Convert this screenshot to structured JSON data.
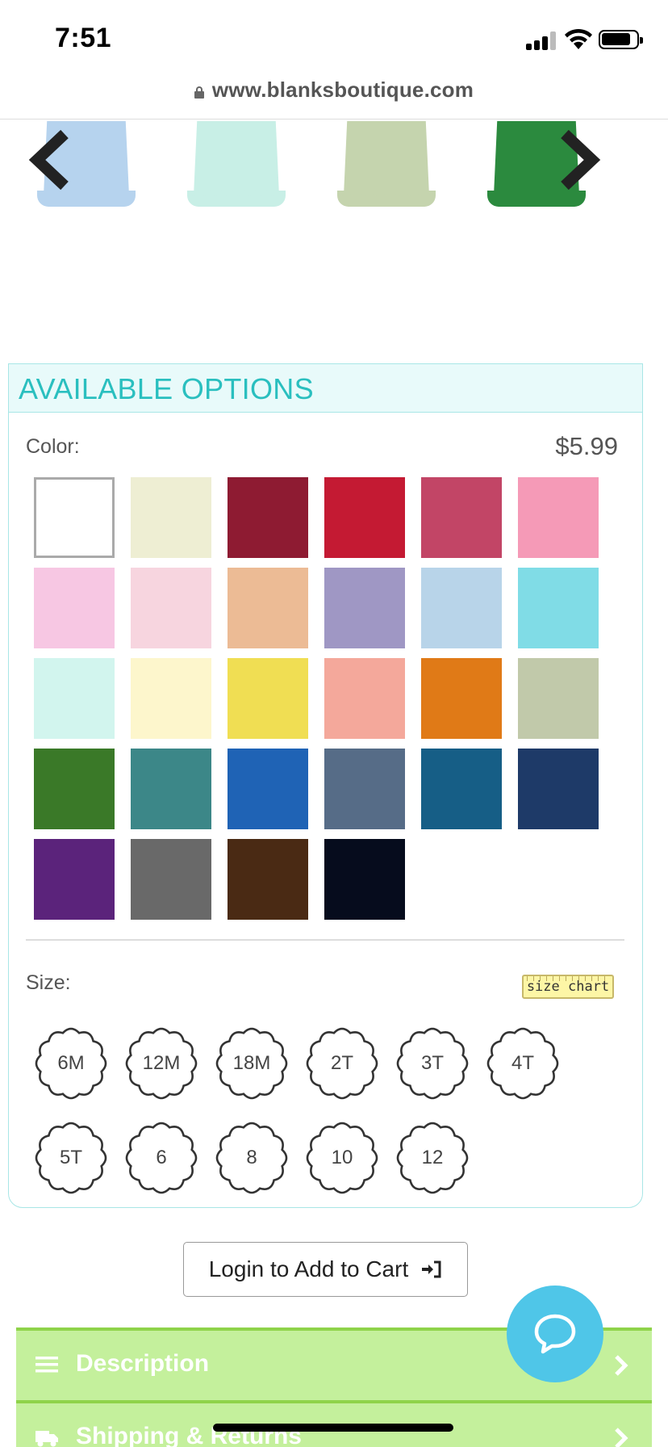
{
  "status_bar": {
    "time": "7:51"
  },
  "browser": {
    "url": "www.blanksboutique.com"
  },
  "carousel": {
    "items": [
      {
        "color": "#b6d3ee"
      },
      {
        "color": "#c8efe6"
      },
      {
        "color": "#c5d4ae"
      },
      {
        "color": "#2b8a3e"
      }
    ]
  },
  "options": {
    "title": "AVAILABLE OPTIONS",
    "color_label": "Color:",
    "price": "$5.99",
    "swatches": [
      "#ffffff",
      "#eeeed3",
      "#8e1b32",
      "#c41a33",
      "#c24566",
      "#f59ab7",
      "#f7c7e3",
      "#f7d5df",
      "#ecbb95",
      "#9f97c4",
      "#b8d4e9",
      "#80dce6",
      "#d2f5ee",
      "#fdf6cc",
      "#f0de53",
      "#f4a89b",
      "#e07a17",
      "#c1c9aa",
      "#3a7928",
      "#3c8788",
      "#1f63b5",
      "#566c87",
      "#165e86",
      "#1e3a68",
      "#5b237b",
      "#696969",
      "#4a2a14",
      "#060c1d"
    ],
    "selected_swatch_index": 0,
    "size_label": "Size:",
    "size_chart": "size chart",
    "sizes": [
      "6M",
      "12M",
      "18M",
      "2T",
      "3T",
      "4T",
      "5T",
      "6",
      "8",
      "10",
      "12"
    ]
  },
  "cart": {
    "login_label": "Login to Add to Cart"
  },
  "accordions": [
    {
      "label": "Description"
    },
    {
      "label": "Shipping & Returns"
    }
  ],
  "colors": {
    "accent": "#2abfbf",
    "accordion": "#c4f09c",
    "chat": "#4fc6e8"
  }
}
